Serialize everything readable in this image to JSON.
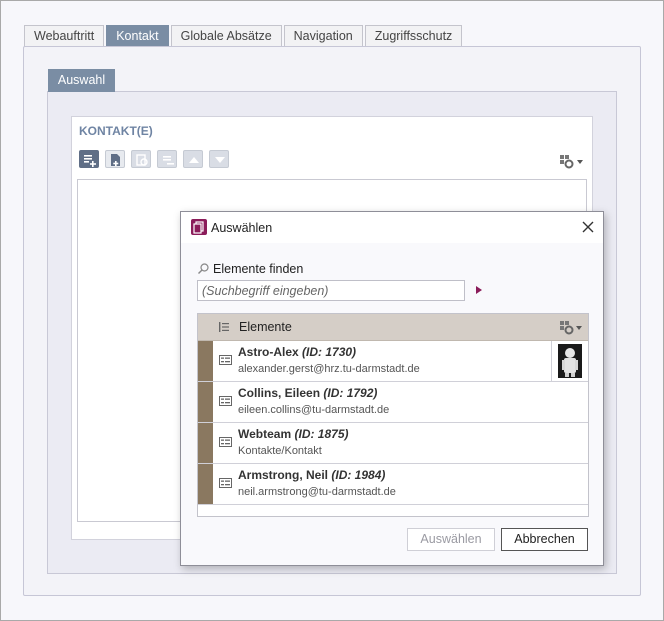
{
  "tabs": [
    {
      "label": "Webauftritt",
      "active": false
    },
    {
      "label": "Kontakt",
      "active": true
    },
    {
      "label": "Globale Absätze",
      "active": false
    },
    {
      "label": "Navigation",
      "active": false
    },
    {
      "label": "Zugriffsschutz",
      "active": false
    }
  ],
  "subtab": {
    "label": "Auswahl"
  },
  "section": {
    "title": "KONTAKT(E)"
  },
  "toolbar": {
    "buttons": [
      {
        "icon": "add-list-icon",
        "enabled": true
      },
      {
        "icon": "add-document-icon",
        "enabled": true
      },
      {
        "icon": "edit-link-icon",
        "enabled": false
      },
      {
        "icon": "remove-icon",
        "enabled": false
      },
      {
        "icon": "arrow-up-icon",
        "enabled": false
      },
      {
        "icon": "arrow-down-icon",
        "enabled": false
      }
    ]
  },
  "dialog": {
    "title": "Auswählen",
    "find_label": "Elemente finden",
    "search_placeholder": "(Suchbegriff eingeben)",
    "grid_header": "Elemente",
    "rows": [
      {
        "name": "Astro-Alex",
        "id": "(ID: 1730)",
        "sub": "alexander.gerst@hrz.tu-darmstadt.de",
        "has_thumb": true
      },
      {
        "name": "Collins, Eileen",
        "id": "(ID: 1792)",
        "sub": "eileen.collins@tu-darmstadt.de",
        "has_thumb": false
      },
      {
        "name": "Webteam",
        "id": "(ID: 1875)",
        "sub": "Kontakte/Kontakt",
        "has_thumb": false
      },
      {
        "name": "Armstrong, Neil",
        "id": "(ID: 1984)",
        "sub": "neil.armstrong@tu-darmstadt.de",
        "has_thumb": false
      }
    ],
    "select_button": "Auswählen",
    "cancel_button": "Abbrechen"
  },
  "colors": {
    "accent": "#7a8da4",
    "section_title": "#6f84a3",
    "dialog_icon": "#8b1c5a",
    "row_marker": "#8a7860",
    "grid_header": "#d5cec7"
  }
}
